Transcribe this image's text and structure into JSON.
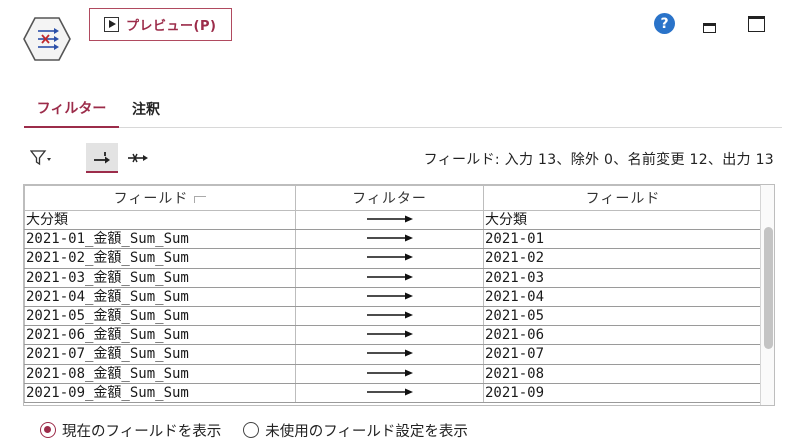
{
  "header": {
    "node_icon": "filter-node-icon",
    "preview_label": "プレビュー(P)",
    "help_icon": "help-icon",
    "help_symbol": "?"
  },
  "tabs": [
    {
      "label": "フィルター",
      "active": true
    },
    {
      "label": "注釈",
      "active": false
    }
  ],
  "toolbar": {
    "filter_icon": "funnel-icon",
    "summary": "フィールド: 入力 13、除外 0、名前変更 12、出力 13"
  },
  "table": {
    "columns": [
      "フィールド",
      "フィルター",
      "フィールド"
    ],
    "rows": [
      {
        "input": "大分類",
        "output": "大分類"
      },
      {
        "input": "2021-01_金額_Sum_Sum",
        "output": "2021-01"
      },
      {
        "input": "2021-02_金額_Sum_Sum",
        "output": "2021-02"
      },
      {
        "input": "2021-03_金額_Sum_Sum",
        "output": "2021-03"
      },
      {
        "input": "2021-04_金額_Sum_Sum",
        "output": "2021-04"
      },
      {
        "input": "2021-05_金額_Sum_Sum",
        "output": "2021-05"
      },
      {
        "input": "2021-06_金額_Sum_Sum",
        "output": "2021-06"
      },
      {
        "input": "2021-07_金額_Sum_Sum",
        "output": "2021-07"
      },
      {
        "input": "2021-08_金額_Sum_Sum",
        "output": "2021-08"
      },
      {
        "input": "2021-09_金額_Sum_Sum",
        "output": "2021-09"
      }
    ]
  },
  "radios": [
    {
      "label": "現在のフィールドを表示",
      "selected": true
    },
    {
      "label": "未使用のフィールド設定を表示",
      "selected": false
    }
  ],
  "colors": {
    "accent": "#9c2c4a",
    "help": "#2a73c9"
  }
}
